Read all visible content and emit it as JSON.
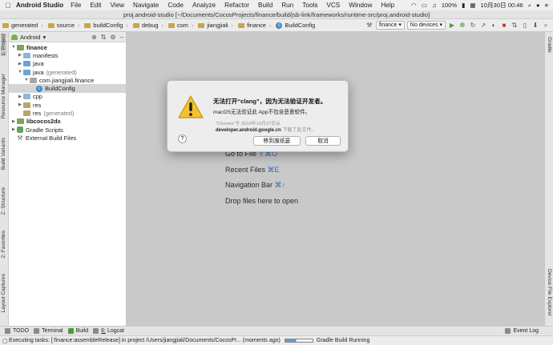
{
  "menubar": {
    "app_name": "Android Studio",
    "items": [
      "File",
      "Edit",
      "View",
      "Navigate",
      "Code",
      "Analyze",
      "Refactor",
      "Build",
      "Run",
      "Tools",
      "VCS",
      "Window",
      "Help"
    ],
    "battery": "100%",
    "datetime": "10月30日  00:46"
  },
  "window": {
    "title": "proj.android-studio [~/Documents/CocosProjects/finance/build/jsb-link/frameworks/runtime-src/proj.android-studio]"
  },
  "navbar": {
    "breadcrumbs": [
      "generated",
      "source",
      "buildConfig",
      "debug",
      "com",
      "jiangjiali",
      "finance",
      "BuildConfig"
    ],
    "run_config": "finance",
    "device": "No devices"
  },
  "left_tabs": [
    "1: Project",
    "Resource Manager",
    "Build Variants",
    "Z: Structure",
    "2: Favorites",
    "Layout Captures"
  ],
  "right_tabs": [
    "Gradle",
    "Device File Explorer"
  ],
  "project_panel": {
    "view_mode": "Android",
    "tree": [
      {
        "label": "finance",
        "suffix": "",
        "indent": 0,
        "icon": "module",
        "open": true,
        "bold": true
      },
      {
        "label": "manifests",
        "suffix": "",
        "indent": 1,
        "icon": "folder",
        "open": false
      },
      {
        "label": "java",
        "suffix": "",
        "indent": 1,
        "icon": "source-folder",
        "open": false
      },
      {
        "label": "java",
        "suffix": "(generated)",
        "indent": 1,
        "icon": "source-folder",
        "open": true
      },
      {
        "label": "com.jiangjiali.finance",
        "suffix": "",
        "indent": 2,
        "icon": "package",
        "open": true
      },
      {
        "label": "BuildConfig",
        "suffix": "",
        "indent": 3,
        "icon": "class",
        "open": null,
        "selected": true
      },
      {
        "label": "cpp",
        "suffix": "",
        "indent": 1,
        "icon": "folder",
        "open": false
      },
      {
        "label": "res",
        "suffix": "",
        "indent": 1,
        "icon": "resource-folder",
        "open": false
      },
      {
        "label": "res",
        "suffix": "(generated)",
        "indent": 1,
        "icon": "resource-folder",
        "open": null
      },
      {
        "label": "libcocos2dx",
        "suffix": "",
        "indent": 0,
        "icon": "module",
        "open": false,
        "bold": true
      },
      {
        "label": "Gradle Scripts",
        "suffix": "",
        "indent": 0,
        "icon": "gradle",
        "open": false
      },
      {
        "label": "External Build Files",
        "suffix": "",
        "indent": 0,
        "icon": "external",
        "open": null
      }
    ]
  },
  "editor_hints": [
    {
      "text": "Go to File",
      "shortcut": "⇧⌘O"
    },
    {
      "text": "Recent Files",
      "shortcut": "⌘E"
    },
    {
      "text": "Navigation Bar",
      "shortcut": "⌘↑"
    },
    {
      "text": "Drop files here to open",
      "shortcut": ""
    }
  ],
  "dialog": {
    "title": "无法打开“clang”，因为无法验证开发者。",
    "message": "macOS无法验证此 App不包含恶意软件。",
    "source_line": "“Chrome”于 2019年10月27日从",
    "source_domain": "developer.android.google.cn",
    "source_suffix": "下载了此文件。",
    "help_label": "?",
    "button_primary": "移到废纸篓",
    "button_cancel": "取消"
  },
  "bottom_tools": [
    {
      "num": "",
      "label": "TODO"
    },
    {
      "num": "",
      "label": "Terminal"
    },
    {
      "num": "",
      "label": "Build"
    },
    {
      "num": "6:",
      "label": "Logcat"
    }
  ],
  "event_log": "Event Log",
  "statusbar": {
    "message": "Executing tasks: [:finance:assembleRelease] in project /Users/jiangjiali/Documents/CocosPr... (moments ago)",
    "task": "Gradle Build Running"
  },
  "colors": {
    "editor_bg": "#c9c9c9",
    "link_key": "#3469b8",
    "warning": "#f2c230"
  }
}
